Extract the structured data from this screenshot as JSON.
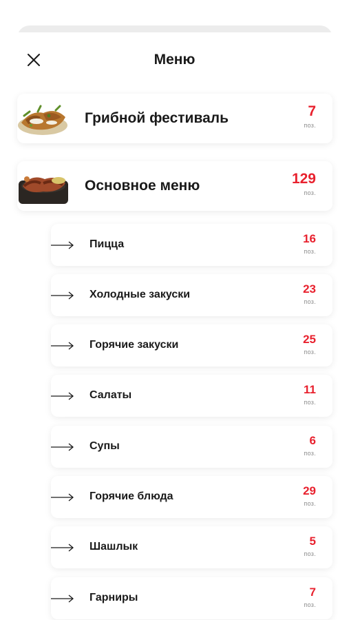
{
  "header": {
    "title": "Меню",
    "close_icon": "close-icon"
  },
  "accent_color": "#e8212e",
  "categories": [
    {
      "label": "Грибной фестиваль",
      "count": "7",
      "unit": "поз.",
      "image": "mushroom-dish-image"
    },
    {
      "label": "Основное меню",
      "count": "129",
      "unit": "поз.",
      "image": "sausage-dish-image"
    }
  ],
  "subcategories": [
    {
      "label": "Пицца",
      "count": "16",
      "unit": "поз."
    },
    {
      "label": "Холодные закуски",
      "count": "23",
      "unit": "поз."
    },
    {
      "label": "Горячие закуски",
      "count": "25",
      "unit": "поз."
    },
    {
      "label": "Салаты",
      "count": "11",
      "unit": "поз."
    },
    {
      "label": "Супы",
      "count": "6",
      "unit": "поз."
    },
    {
      "label": "Горячие блюда",
      "count": "29",
      "unit": "поз."
    },
    {
      "label": "Шашлык",
      "count": "5",
      "unit": "поз."
    },
    {
      "label": "Гарниры",
      "count": "7",
      "unit": "поз."
    }
  ]
}
